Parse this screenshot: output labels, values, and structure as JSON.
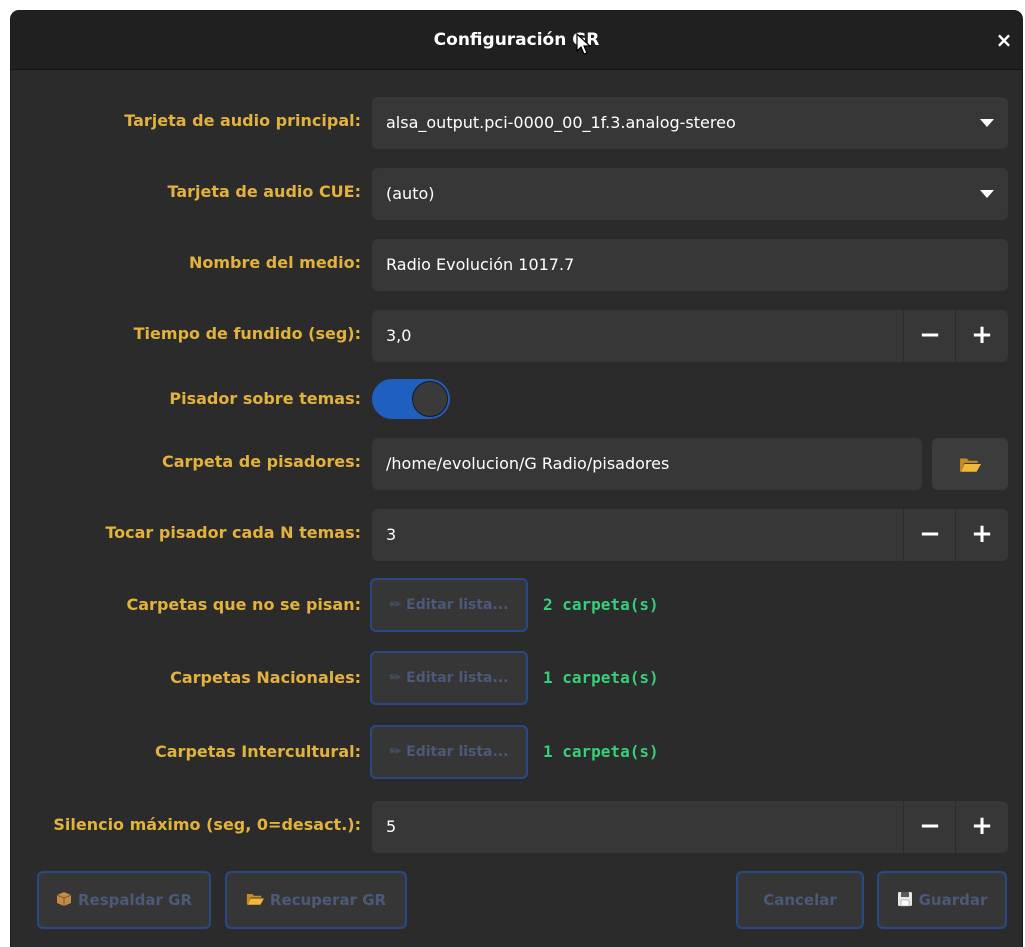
{
  "dialog": {
    "title": "Configuración GR",
    "close_label": "×"
  },
  "fields": {
    "main_audio": {
      "label": "Tarjeta de audio principal:",
      "value": "alsa_output.pci-0000_00_1f.3.analog-stereo"
    },
    "cue_audio": {
      "label": "Tarjeta de audio CUE:",
      "value": "(auto)"
    },
    "media_name": {
      "label": "Nombre del medio:",
      "value": "Radio Evolución 1017.7"
    },
    "fade_time": {
      "label": "Tiempo de fundido (seg):",
      "value": "3,0"
    },
    "stepper_on_tracks": {
      "label": "Pisador sobre temas:",
      "enabled": true
    },
    "stepper_folder": {
      "label": "Carpeta de pisadores:",
      "value": "/home/evolucion/G Radio/pisadores"
    },
    "stepper_every_n": {
      "label": "Tocar pisador cada N temas:",
      "value": "3"
    },
    "no_step_folders": {
      "label": "Carpetas que no se pisan:",
      "button": "✏ Editar lista...",
      "count": "2 carpeta(s)"
    },
    "national_folders": {
      "label": "Carpetas Nacionales:",
      "button": "✏ Editar lista...",
      "count": "1 carpeta(s)"
    },
    "intercultural_folders": {
      "label": "Carpetas Intercultural:",
      "button": "✏ Editar lista...",
      "count": "1 carpeta(s)"
    },
    "max_silence": {
      "label": "Silencio máximo (seg, 0=desact.):",
      "value": "5"
    }
  },
  "spin": {
    "minus": "−",
    "plus": "+"
  },
  "buttons": {
    "backup": "Respaldar GR",
    "restore": "Recuperar GR",
    "cancel": "Cancelar",
    "save": "Guardar"
  },
  "colors": {
    "label": "#e3b23c",
    "count": "#35d07a",
    "switch_on": "#1f5fc0",
    "button_border": "#274a86"
  }
}
